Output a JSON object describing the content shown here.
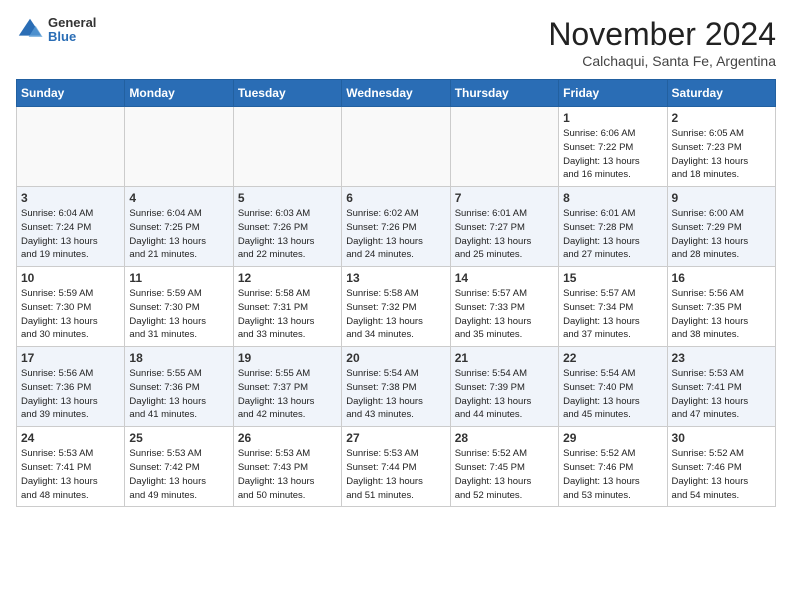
{
  "header": {
    "logo": {
      "general": "General",
      "blue": "Blue"
    },
    "title": "November 2024",
    "subtitle": "Calchaqui, Santa Fe, Argentina"
  },
  "calendar": {
    "days_of_week": [
      "Sunday",
      "Monday",
      "Tuesday",
      "Wednesday",
      "Thursday",
      "Friday",
      "Saturday"
    ],
    "weeks": [
      [
        {
          "day": "",
          "info": ""
        },
        {
          "day": "",
          "info": ""
        },
        {
          "day": "",
          "info": ""
        },
        {
          "day": "",
          "info": ""
        },
        {
          "day": "",
          "info": ""
        },
        {
          "day": "1",
          "info": "Sunrise: 6:06 AM\nSunset: 7:22 PM\nDaylight: 13 hours\nand 16 minutes."
        },
        {
          "day": "2",
          "info": "Sunrise: 6:05 AM\nSunset: 7:23 PM\nDaylight: 13 hours\nand 18 minutes."
        }
      ],
      [
        {
          "day": "3",
          "info": "Sunrise: 6:04 AM\nSunset: 7:24 PM\nDaylight: 13 hours\nand 19 minutes."
        },
        {
          "day": "4",
          "info": "Sunrise: 6:04 AM\nSunset: 7:25 PM\nDaylight: 13 hours\nand 21 minutes."
        },
        {
          "day": "5",
          "info": "Sunrise: 6:03 AM\nSunset: 7:26 PM\nDaylight: 13 hours\nand 22 minutes."
        },
        {
          "day": "6",
          "info": "Sunrise: 6:02 AM\nSunset: 7:26 PM\nDaylight: 13 hours\nand 24 minutes."
        },
        {
          "day": "7",
          "info": "Sunrise: 6:01 AM\nSunset: 7:27 PM\nDaylight: 13 hours\nand 25 minutes."
        },
        {
          "day": "8",
          "info": "Sunrise: 6:01 AM\nSunset: 7:28 PM\nDaylight: 13 hours\nand 27 minutes."
        },
        {
          "day": "9",
          "info": "Sunrise: 6:00 AM\nSunset: 7:29 PM\nDaylight: 13 hours\nand 28 minutes."
        }
      ],
      [
        {
          "day": "10",
          "info": "Sunrise: 5:59 AM\nSunset: 7:30 PM\nDaylight: 13 hours\nand 30 minutes."
        },
        {
          "day": "11",
          "info": "Sunrise: 5:59 AM\nSunset: 7:30 PM\nDaylight: 13 hours\nand 31 minutes."
        },
        {
          "day": "12",
          "info": "Sunrise: 5:58 AM\nSunset: 7:31 PM\nDaylight: 13 hours\nand 33 minutes."
        },
        {
          "day": "13",
          "info": "Sunrise: 5:58 AM\nSunset: 7:32 PM\nDaylight: 13 hours\nand 34 minutes."
        },
        {
          "day": "14",
          "info": "Sunrise: 5:57 AM\nSunset: 7:33 PM\nDaylight: 13 hours\nand 35 minutes."
        },
        {
          "day": "15",
          "info": "Sunrise: 5:57 AM\nSunset: 7:34 PM\nDaylight: 13 hours\nand 37 minutes."
        },
        {
          "day": "16",
          "info": "Sunrise: 5:56 AM\nSunset: 7:35 PM\nDaylight: 13 hours\nand 38 minutes."
        }
      ],
      [
        {
          "day": "17",
          "info": "Sunrise: 5:56 AM\nSunset: 7:36 PM\nDaylight: 13 hours\nand 39 minutes."
        },
        {
          "day": "18",
          "info": "Sunrise: 5:55 AM\nSunset: 7:36 PM\nDaylight: 13 hours\nand 41 minutes."
        },
        {
          "day": "19",
          "info": "Sunrise: 5:55 AM\nSunset: 7:37 PM\nDaylight: 13 hours\nand 42 minutes."
        },
        {
          "day": "20",
          "info": "Sunrise: 5:54 AM\nSunset: 7:38 PM\nDaylight: 13 hours\nand 43 minutes."
        },
        {
          "day": "21",
          "info": "Sunrise: 5:54 AM\nSunset: 7:39 PM\nDaylight: 13 hours\nand 44 minutes."
        },
        {
          "day": "22",
          "info": "Sunrise: 5:54 AM\nSunset: 7:40 PM\nDaylight: 13 hours\nand 45 minutes."
        },
        {
          "day": "23",
          "info": "Sunrise: 5:53 AM\nSunset: 7:41 PM\nDaylight: 13 hours\nand 47 minutes."
        }
      ],
      [
        {
          "day": "24",
          "info": "Sunrise: 5:53 AM\nSunset: 7:41 PM\nDaylight: 13 hours\nand 48 minutes."
        },
        {
          "day": "25",
          "info": "Sunrise: 5:53 AM\nSunset: 7:42 PM\nDaylight: 13 hours\nand 49 minutes."
        },
        {
          "day": "26",
          "info": "Sunrise: 5:53 AM\nSunset: 7:43 PM\nDaylight: 13 hours\nand 50 minutes."
        },
        {
          "day": "27",
          "info": "Sunrise: 5:53 AM\nSunset: 7:44 PM\nDaylight: 13 hours\nand 51 minutes."
        },
        {
          "day": "28",
          "info": "Sunrise: 5:52 AM\nSunset: 7:45 PM\nDaylight: 13 hours\nand 52 minutes."
        },
        {
          "day": "29",
          "info": "Sunrise: 5:52 AM\nSunset: 7:46 PM\nDaylight: 13 hours\nand 53 minutes."
        },
        {
          "day": "30",
          "info": "Sunrise: 5:52 AM\nSunset: 7:46 PM\nDaylight: 13 hours\nand 54 minutes."
        }
      ]
    ]
  }
}
